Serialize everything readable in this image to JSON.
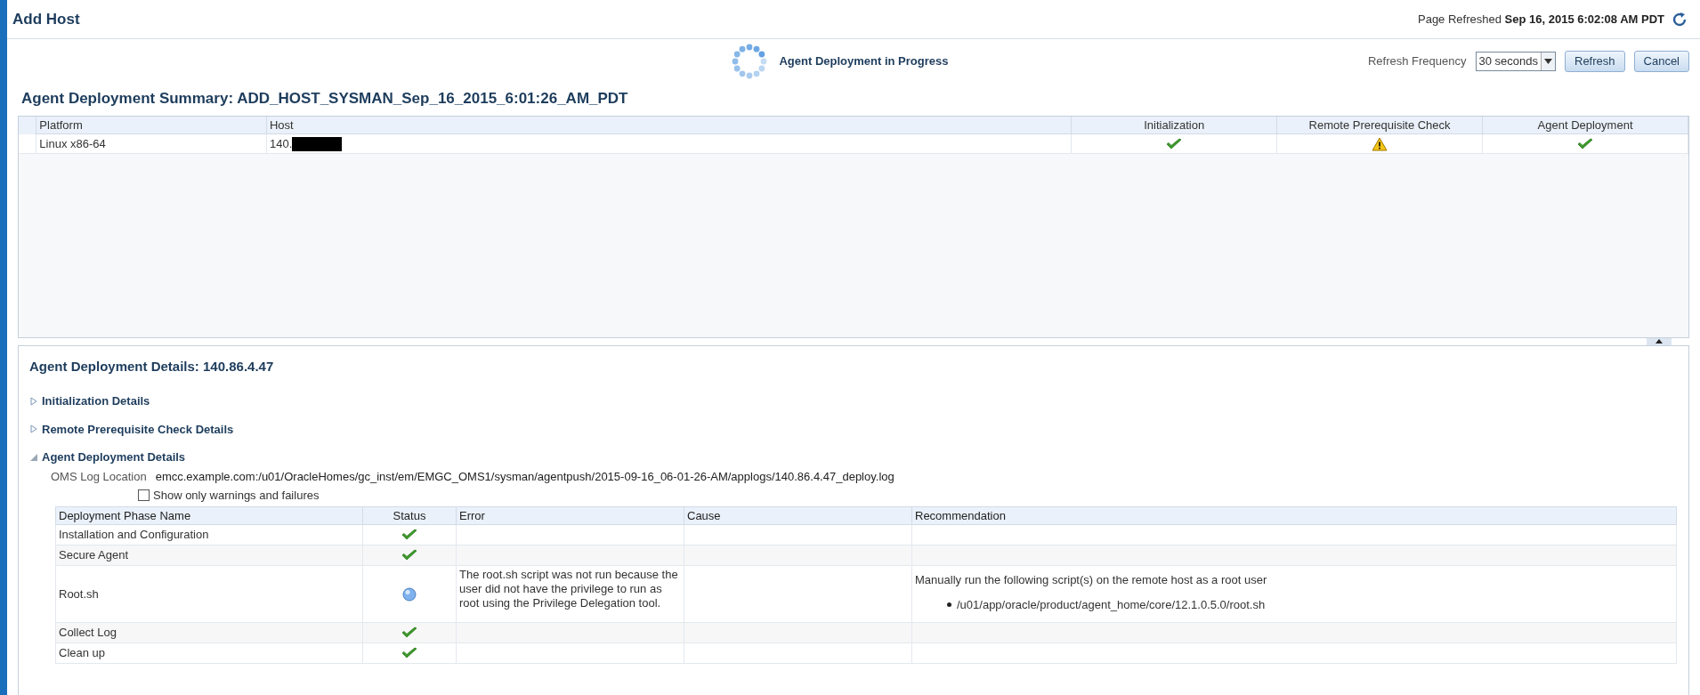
{
  "page_title": "Add Host",
  "refreshed": {
    "label": "Page Refreshed",
    "value": "Sep 16, 2015 6:02:08 AM PDT"
  },
  "progress": {
    "label": "Agent Deployment in Progress"
  },
  "refresh_frequency": {
    "label": "Refresh Frequency",
    "value": "30 seconds"
  },
  "buttons": [
    "Refresh",
    "Cancel"
  ],
  "summary": {
    "title": "Agent Deployment Summary: ADD_HOST_SYSMAN_Sep_16_2015_6:01:26_AM_PDT",
    "columns": [
      "Platform",
      "Host",
      "Initialization",
      "Remote Prerequisite Check",
      "Agent Deployment"
    ],
    "rows": [
      {
        "platform": "Linux x86-64",
        "host": "140.",
        "host_redacted": true,
        "statuses": [
          {
            "kind": "success"
          },
          {
            "kind": "warning"
          },
          {
            "kind": "success"
          }
        ]
      }
    ]
  },
  "details": {
    "title": "Agent Deployment Details: 140.86.4.47",
    "sections": [
      {
        "label": "Initialization Details",
        "expanded": false
      },
      {
        "label": "Remote Prerequisite Check Details",
        "expanded": false
      },
      {
        "label": "Agent Deployment Details",
        "expanded": true
      }
    ],
    "log_label": "OMS Log Location",
    "log_value": "emcc.example.com:/u01/OracleHomes/gc_inst/em/EMGC_OMS1/sysman/agentpush/2015-09-16_06-01-26-AM/applogs/140.86.4.47_deploy.log",
    "filter": {
      "label": "Show only warnings and failures",
      "checked": false
    },
    "columns": [
      "Deployment Phase Name",
      "Status",
      "Error",
      "Cause",
      "Recommendation"
    ],
    "rows": [
      {
        "name": "Installation and Configuration",
        "status": {
          "kind": "success"
        }
      },
      {
        "name": "Secure Agent",
        "status": {
          "kind": "success"
        }
      },
      {
        "name": "Root.sh",
        "status": {
          "kind": "pending"
        },
        "error": "The root.sh script was not run because the user did not have the privilege to run as root using the Privilege Delegation tool.",
        "recommendation": "Manually run the following script(s) on the remote host as a root user",
        "recommendation_items": [
          "/u01/app/oracle/product/agent_home/core/12.1.0.5.0/root.sh"
        ]
      },
      {
        "name": "Collect Log",
        "status": {
          "kind": "success"
        }
      },
      {
        "name": "Clean up",
        "status": {
          "kind": "success"
        }
      }
    ]
  }
}
